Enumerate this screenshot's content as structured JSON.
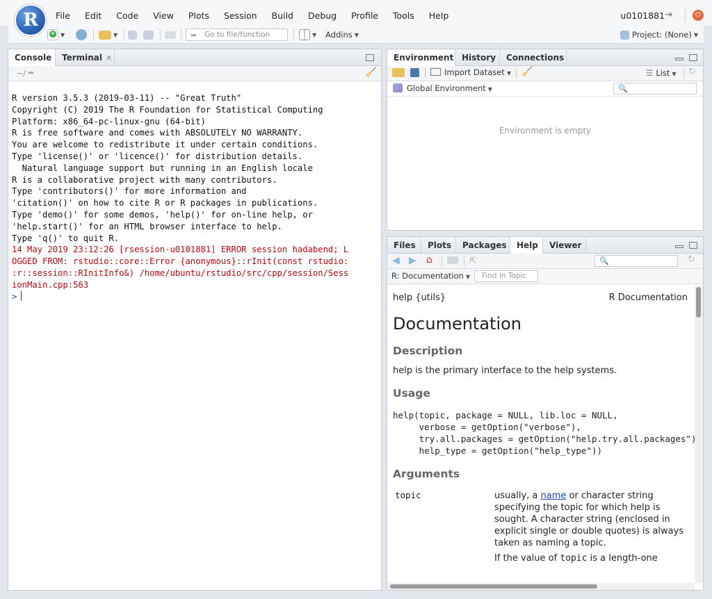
{
  "app": {
    "logo_letter": "R",
    "menus": [
      "File",
      "Edit",
      "Code",
      "View",
      "Plots",
      "Session",
      "Build",
      "Debug",
      "Profile",
      "Tools",
      "Help"
    ],
    "user": "u0101881"
  },
  "toolbar": {
    "goto_placeholder": "Go to file/function",
    "addins_label": "Addins",
    "project_label": "Project: (None)"
  },
  "console_pane": {
    "tabs": [
      {
        "label": "Console",
        "active": true
      },
      {
        "label": "Terminal",
        "active": false
      }
    ],
    "path": "~/",
    "lines": [
      "R version 3.5.3 (2019-03-11) -- \"Great Truth\"",
      "Copyright (C) 2019 The R Foundation for Statistical Computing",
      "Platform: x86_64-pc-linux-gnu (64-bit)",
      "",
      "R is free software and comes with ABSOLUTELY NO WARRANTY.",
      "You are welcome to redistribute it under certain conditions.",
      "Type 'license()' or 'licence()' for distribution details.",
      "",
      "  Natural language support but running in an English locale",
      "",
      "R is a collaborative project with many contributors.",
      "Type 'contributors()' for more information and",
      "'citation()' on how to cite R or R packages in publications.",
      "",
      "Type 'demo()' for some demos, 'help()' for on-line help, or",
      "'help.start()' for an HTML browser interface to help.",
      "Type 'q()' to quit R.",
      ""
    ],
    "error_lines": [
      "14 May 2019 23:12:26 [rsession-u0101881] ERROR session hadabend; L",
      "OGGED FROM: rstudio::core::Error {anonymous}::rInit(const rstudio:",
      ":r::session::RInitInfo&) /home/ubuntu/rstudio/src/cpp/session/Sess",
      "ionMain.cpp:563"
    ],
    "prompt": ">"
  },
  "env_pane": {
    "tabs": [
      {
        "label": "Environment",
        "active": true
      },
      {
        "label": "History",
        "active": false
      },
      {
        "label": "Connections",
        "active": false
      }
    ],
    "import_label": "Import Dataset",
    "list_label": "List",
    "scope_label": "Global Environment",
    "empty_message": "Environment is empty"
  },
  "files_pane": {
    "tabs": [
      {
        "label": "Files",
        "active": false
      },
      {
        "label": "Plots",
        "active": false
      },
      {
        "label": "Packages",
        "active": false
      },
      {
        "label": "Help",
        "active": true
      },
      {
        "label": "Viewer",
        "active": false
      }
    ],
    "doc_selector": "R: Documentation",
    "find_placeholder": "Find in Topic"
  },
  "help_doc": {
    "header_left": "help {utils}",
    "header_right": "R Documentation",
    "title": "Documentation",
    "description_heading": "Description",
    "description_text": "help is the primary interface to the help systems.",
    "usage_heading": "Usage",
    "usage_code": [
      "help(topic, package = NULL, lib.loc = NULL,",
      "     verbose = getOption(\"verbose\"),",
      "     try.all.packages = getOption(\"help.try.all.packages\"),",
      "     help_type = getOption(\"help_type\"))"
    ],
    "arguments_heading": "Arguments",
    "arg_topic_name": "topic",
    "arg_topic_desc_pre": "usually, a ",
    "arg_topic_link": "name",
    "arg_topic_desc_post": " or character string specifying the topic for which help is sought. A character string (enclosed in explicit single or double quotes) is always taken as naming a topic.",
    "arg_topic_more_pre": "If the value of ",
    "arg_topic_more_code": "topic",
    "arg_topic_more_post": " is a length-one"
  },
  "colors": {
    "error": "#c5060b",
    "prompt": "#1f3dc4",
    "link": "#1a3fc2",
    "logo": "#2a62b8"
  }
}
